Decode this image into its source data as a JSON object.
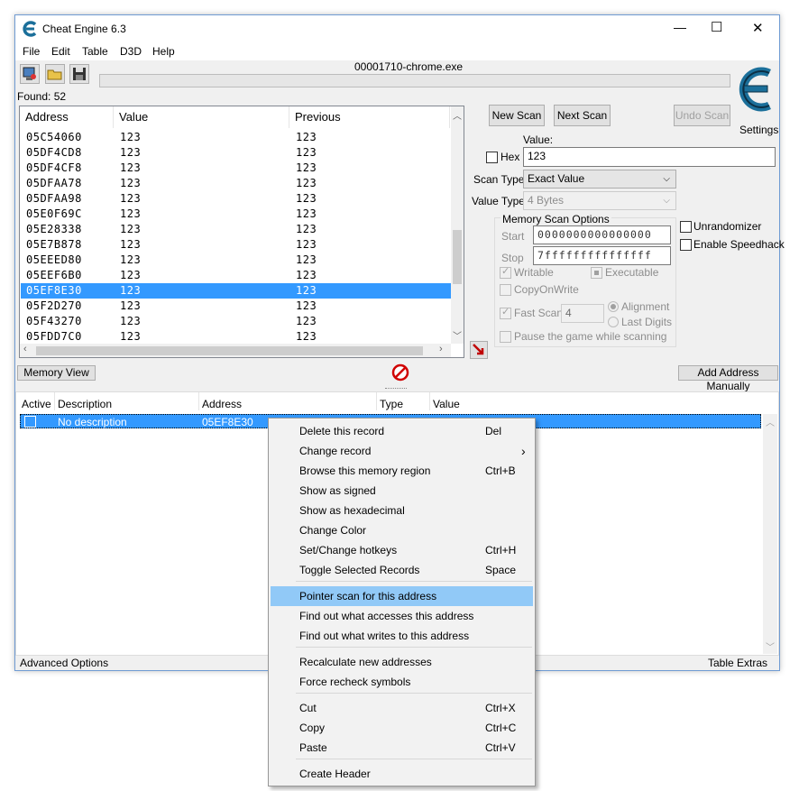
{
  "window": {
    "title": "Cheat Engine 6.3",
    "minimize_glyph": "—",
    "maximize_glyph": "☐",
    "close_glyph": "✕"
  },
  "menu": [
    "File",
    "Edit",
    "Table",
    "D3D",
    "Help"
  ],
  "process_name": "00001710-chrome.exe",
  "found_label": "Found: 52",
  "settings_label": "Settings",
  "scan_results": {
    "columns": [
      "Address",
      "Value",
      "Previous"
    ],
    "rows": [
      {
        "address": "05C54060",
        "value": "123",
        "previous": "123"
      },
      {
        "address": "05DF4CD8",
        "value": "123",
        "previous": "123"
      },
      {
        "address": "05DF4CF8",
        "value": "123",
        "previous": "123"
      },
      {
        "address": "05DFAA78",
        "value": "123",
        "previous": "123"
      },
      {
        "address": "05DFAA98",
        "value": "123",
        "previous": "123"
      },
      {
        "address": "05E0F69C",
        "value": "123",
        "previous": "123"
      },
      {
        "address": "05E28338",
        "value": "123",
        "previous": "123"
      },
      {
        "address": "05E7B878",
        "value": "123",
        "previous": "123"
      },
      {
        "address": "05EEED80",
        "value": "123",
        "previous": "123"
      },
      {
        "address": "05EEF6B0",
        "value": "123",
        "previous": "123"
      },
      {
        "address": "05EF8E30",
        "value": "123",
        "previous": "123"
      },
      {
        "address": "05F2D270",
        "value": "123",
        "previous": "123"
      },
      {
        "address": "05F43270",
        "value": "123",
        "previous": "123"
      },
      {
        "address": "05FDD7C0",
        "value": "123",
        "previous": "123"
      }
    ],
    "selected_index": 10
  },
  "scan_panel": {
    "new_scan": "New Scan",
    "next_scan": "Next Scan",
    "undo_scan": "Undo Scan",
    "value_label": "Value:",
    "hex_label": "Hex",
    "value": "123",
    "scan_type_label": "Scan Type",
    "scan_type_value": "Exact Value",
    "value_type_label": "Value Type",
    "value_type_value": "4 Bytes",
    "memory_scan_options": "Memory Scan Options",
    "start_label": "Start",
    "start_value": "0000000000000000",
    "stop_label": "Stop",
    "stop_value": "7fffffffffffffff",
    "writable": "Writable",
    "executable": "Executable",
    "copy_on_write": "CopyOnWrite",
    "fast_scan": "Fast Scan",
    "fast_scan_value": "4",
    "alignment": "Alignment",
    "last_digits": "Last Digits",
    "pause_game": "Pause the game while scanning",
    "unrandomizer": "Unrandomizer",
    "enable_speedhack": "Enable Speedhack"
  },
  "memory_view_button": "Memory View",
  "add_address_button": "Add Address Manually",
  "address_list": {
    "columns": [
      "Active",
      "Description",
      "Address",
      "Type",
      "Value"
    ],
    "rows": [
      {
        "description": "No description",
        "address": "05EF8E30"
      }
    ]
  },
  "footer": {
    "advanced_options": "Advanced Options",
    "table_extras": "Table Extras"
  },
  "context_menu": {
    "items": [
      {
        "label": "Delete this record",
        "shortcut": "Del"
      },
      {
        "label": "Change record",
        "shortcut": "›"
      },
      {
        "label": "Browse this memory region",
        "shortcut": "Ctrl+B"
      },
      {
        "label": "Show as signed",
        "shortcut": ""
      },
      {
        "label": "Show as hexadecimal",
        "shortcut": ""
      },
      {
        "label": "Change Color",
        "shortcut": ""
      },
      {
        "label": "Set/Change hotkeys",
        "shortcut": "Ctrl+H"
      },
      {
        "label": "Toggle Selected Records",
        "shortcut": "Space"
      },
      {
        "label": "Pointer scan for this address",
        "shortcut": ""
      },
      {
        "label": "Find out what accesses this address",
        "shortcut": ""
      },
      {
        "label": "Find out what writes to this address",
        "shortcut": ""
      },
      {
        "label": "Recalculate new addresses",
        "shortcut": ""
      },
      {
        "label": "Force recheck symbols",
        "shortcut": ""
      },
      {
        "label": "Cut",
        "shortcut": "Ctrl+X"
      },
      {
        "label": "Copy",
        "shortcut": "Ctrl+C"
      },
      {
        "label": "Paste",
        "shortcut": "Ctrl+V"
      },
      {
        "label": "Create Header",
        "shortcut": ""
      }
    ],
    "highlighted_index": 8
  },
  "colors": {
    "selection": "#3399ff",
    "menu_highlight": "#91c9f7",
    "logo": "#1b6f9a"
  }
}
